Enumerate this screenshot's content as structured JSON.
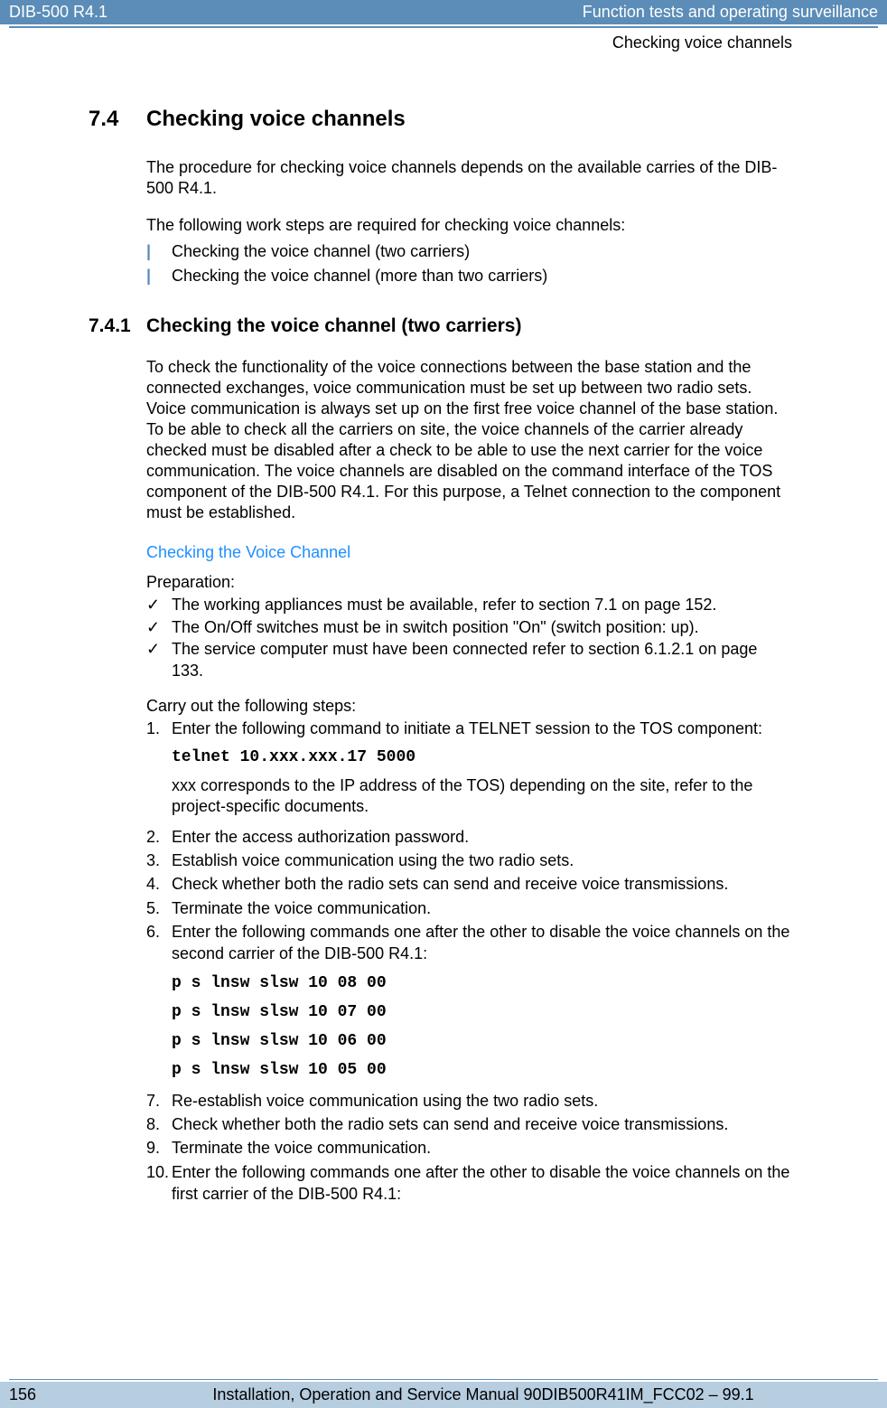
{
  "header": {
    "left": "DIB-500 R4.1",
    "right": "Function tests and operating surveillance"
  },
  "subheader": "Checking voice channels",
  "s7_4": {
    "num": "7.4",
    "title": "Checking voice channels",
    "p1": "The procedure for checking voice channels depends on the available carries of the DIB-500 R4.1.",
    "p2": "The following work steps are required for checking voice channels:",
    "bars": [
      "Checking the voice channel (two carriers)",
      "Checking the voice channel (more than two carriers)"
    ]
  },
  "s7_4_1": {
    "num": "7.4.1",
    "title": "Checking the voice channel (two carriers)",
    "p1": "To check the functionality of the voice connections between the base station and the connected exchanges, voice communication must be set up between two radio sets. Voice communication is always set up on the first free voice channel of the base station. To be able to check all the carriers on site, the voice channels of the carrier already checked must be disabled after a check to be able to use the next carrier for the voice communication. The voice channels are disabled on the command interface of the TOS component of the DIB-500 R4.1. For this purpose, a Telnet connection to the component must be established.",
    "blueHeading": "Checking the Voice Channel",
    "prepLabel": "Preparation:",
    "prep": [
      "The working appliances must be available, refer to section 7.1 on page 152.",
      "The On/Off switches must be in switch position \"On\" (switch position: up).",
      "The service computer must have been connected refer to section 6.1.2.1 on page 133."
    ],
    "carryOut": "Carry out the following steps:",
    "steps": {
      "s1": "Enter the following command to initiate a TELNET session to the TOS component:",
      "s1code": "telnet 10.xxx.xxx.17 5000",
      "s1note": "xxx corresponds to the IP address of the TOS) depending on the site, refer to the project-specific documents.",
      "s2": "Enter the access authorization password.",
      "s3": "Establish voice communication using the two radio sets.",
      "s4": "Check whether both the radio sets can send and receive voice transmissions.",
      "s5": "Terminate the voice communication.",
      "s6": "Enter the following commands one after the other to disable the voice channels on the second carrier of the DIB-500 R4.1:",
      "s6code": [
        "p s lnsw slsw 10 08 00",
        "p s lnsw slsw 10 07 00",
        "p s lnsw slsw 10 06 00",
        "p s lnsw slsw 10 05 00"
      ],
      "s7": "Re-establish voice communication using the two radio sets.",
      "s8": "Check whether both the radio sets can send and receive voice transmissions.",
      "s9": "Terminate the voice communication.",
      "s10": "Enter the following commands one after the other to disable the voice channels on the first carrier of the DIB-500 R4.1:"
    }
  },
  "footer": {
    "page": "156",
    "text": "Installation, Operation and Service Manual 90DIB500R41IM_FCC02 – 99.1"
  }
}
